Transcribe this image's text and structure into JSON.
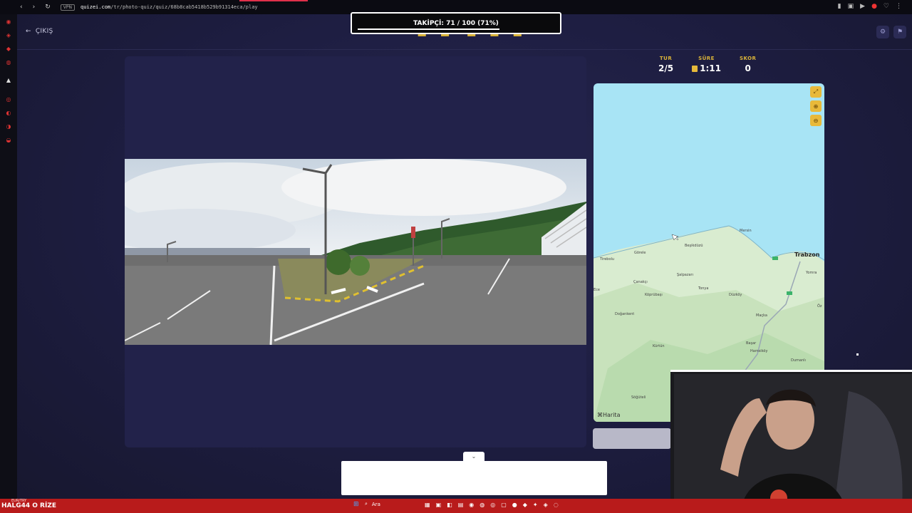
{
  "browser": {
    "vpn": "VPN",
    "url_domain": "quizei.com",
    "url_path": "/tr/photo-quiz/quiz/68b8cab5418b529b91314eca/play",
    "nav_icons": [
      "back-icon",
      "forward-icon",
      "reload-icon"
    ]
  },
  "header": {
    "exit_label": "ÇIKIŞ",
    "settings_icon": "gear-icon",
    "report_icon": "flag-icon"
  },
  "overlay": {
    "followers_label": "TAKİPÇİ: 71 / 100 (71%)",
    "followers_progress": 0.71
  },
  "stats": {
    "round_label": "TUR",
    "round_value": "2/5",
    "time_label": "SÜRE",
    "time_value": "1:11",
    "score_label": "SKOR",
    "score_value": "0"
  },
  "map": {
    "credit": "Harita",
    "controls": [
      "expand-icon",
      "zoom-in-icon",
      "zoom-out-icon"
    ],
    "places": [
      "Trabzon",
      "Mersin",
      "Beşikdüzü",
      "Görele",
      "Tirebolu",
      "Şalpazarı",
      "Çanakçı",
      "Tonya",
      "Düzköy",
      "Yomra",
      "Maçka",
      "Köprübaşı",
      "Doğankent",
      "Kürtün",
      "Başar",
      "Hamsiköy",
      "Dumanlı",
      "Söğüteli",
      "Öz",
      "Ece"
    ]
  },
  "bottom": {
    "chevron": "⌄"
  },
  "taskbar": {
    "ticker_top": "EUR/TRY",
    "ticker": "HALG44 O RİZE",
    "search_label": "Ara"
  }
}
